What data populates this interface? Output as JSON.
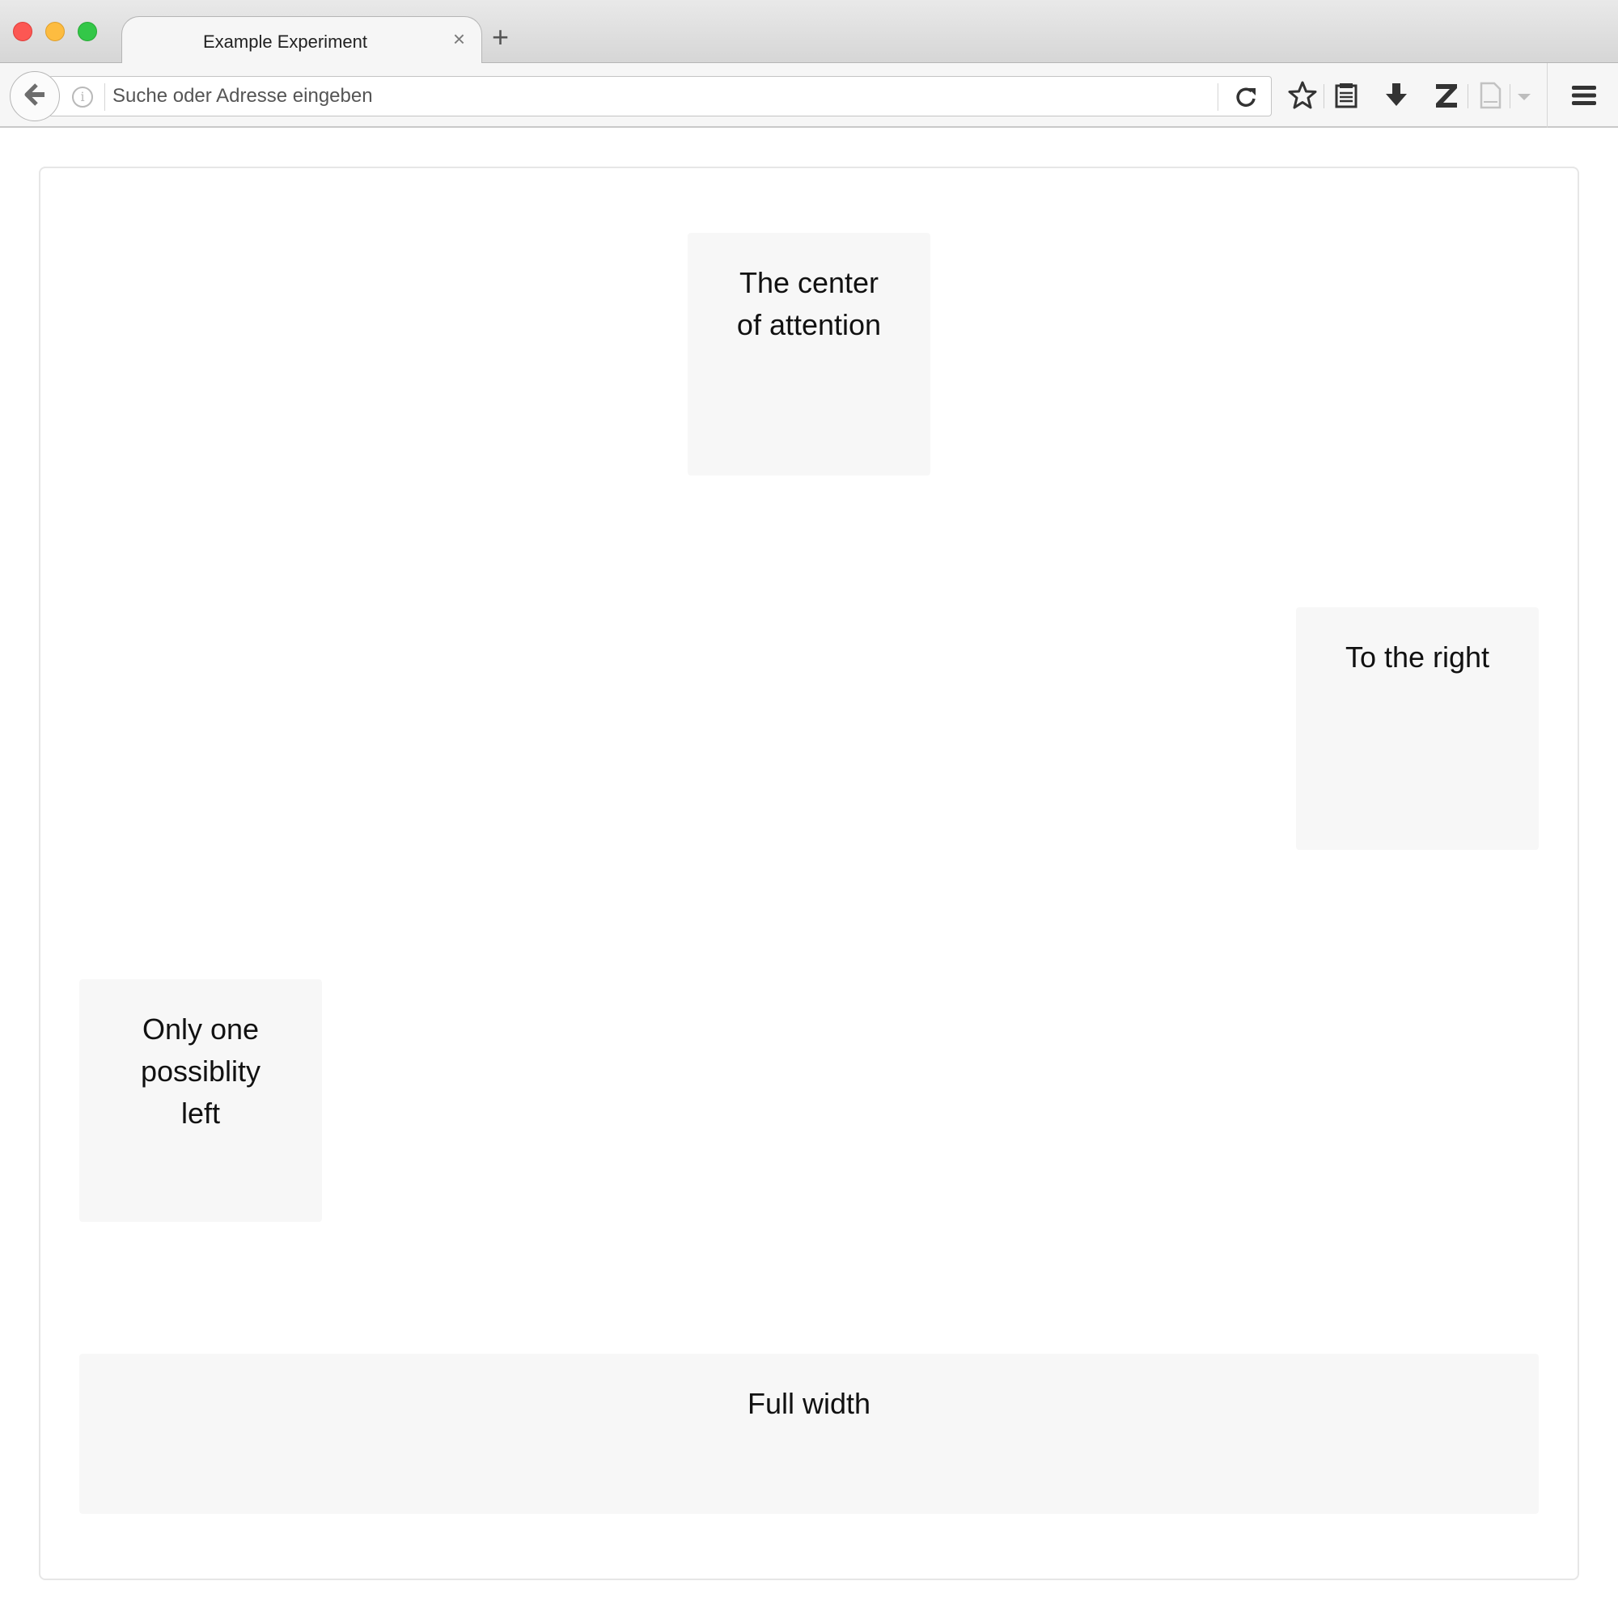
{
  "browser": {
    "tab_title": "Example Experiment",
    "tab_close": "×",
    "new_tab": "+",
    "url_placeholder": "Suche oder Adresse eingeben",
    "url_value": "",
    "info_glyph": "i",
    "toolbar_icons": [
      "back-arrow-icon",
      "reload-icon",
      "star-icon",
      "reading-list-icon",
      "download-icon",
      "zotero-icon",
      "page-icon",
      "dropdown-arrow-icon",
      "hamburger-menu-icon"
    ]
  },
  "page": {
    "boxes": {
      "center": "The center of attention",
      "right": "To the right",
      "left": "Only one possiblity left",
      "full": "Full width"
    }
  },
  "colors": {
    "box_background": "#f7f7f7",
    "card_border": "#e6e6e6",
    "traffic_close": "#fc5753",
    "traffic_min": "#fdbc40",
    "traffic_max": "#33c748"
  }
}
